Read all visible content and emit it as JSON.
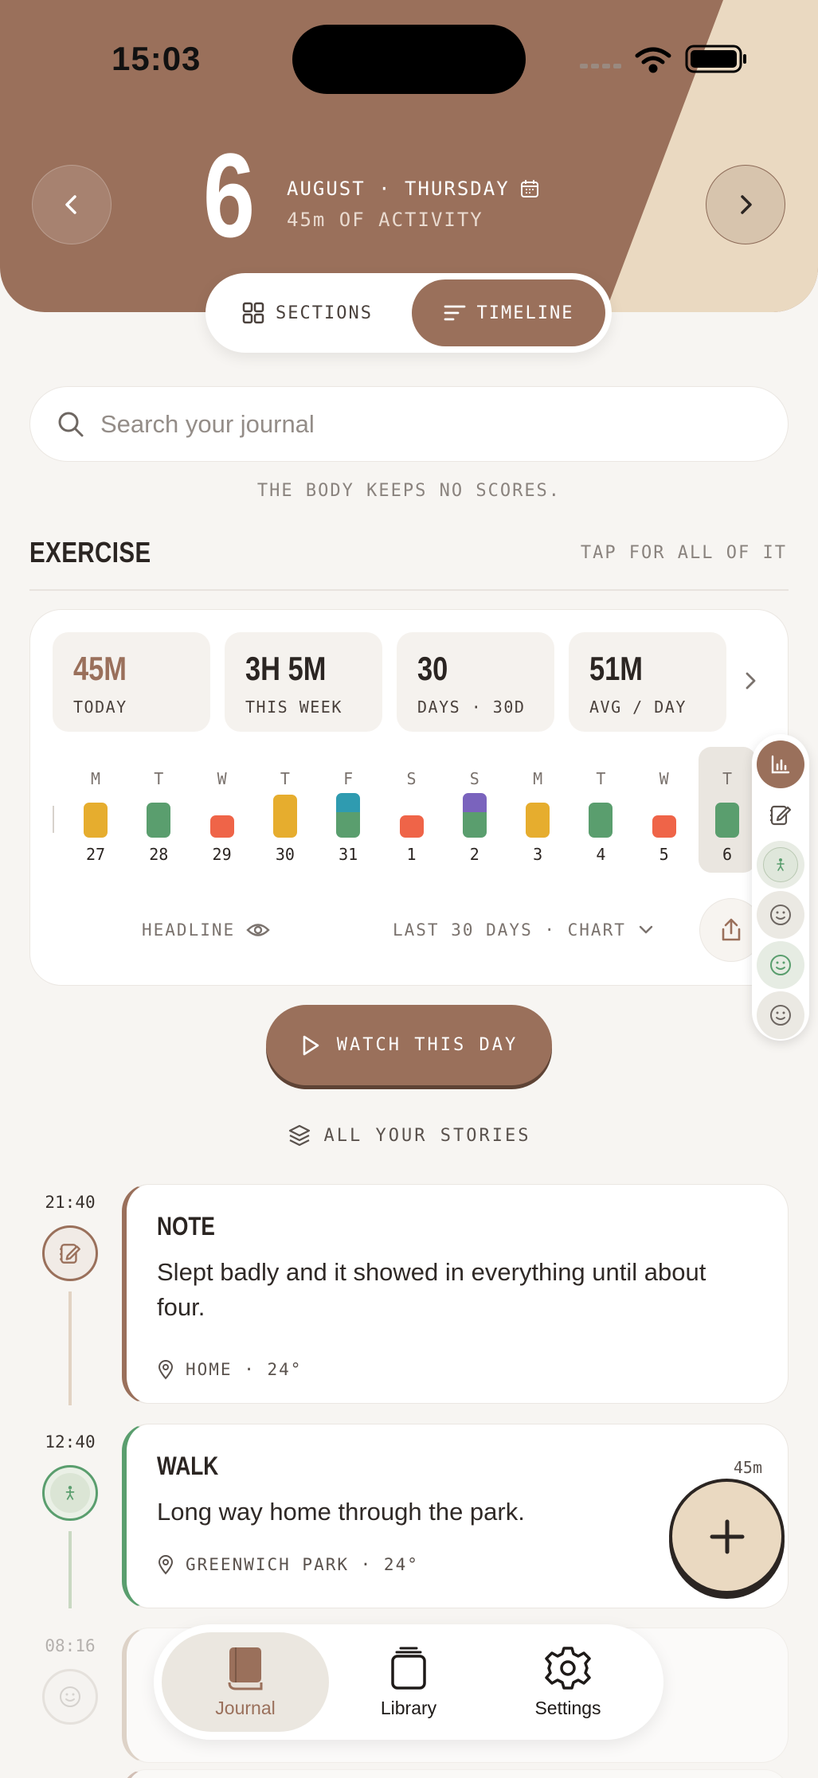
{
  "status_bar": {
    "time": "15:03"
  },
  "header": {
    "day": "6",
    "date": "AUGUST · THURSDAY",
    "activity": "45m OF ACTIVITY"
  },
  "view_toggle": {
    "sections_label": "SECTIONS",
    "timeline_label": "TIMELINE",
    "selected": "TIMELINE"
  },
  "search": {
    "placeholder": "Search your journal"
  },
  "tagline": "THE BODY KEEPS NO SCORES.",
  "section": {
    "title": "EXERCISE",
    "link": "TAP FOR ALL OF IT"
  },
  "stats": [
    {
      "value": "45M",
      "label": "TODAY"
    },
    {
      "value": "3H 5M",
      "label": "THIS WEEK"
    },
    {
      "value": "30",
      "label": "DAYS · 30D"
    },
    {
      "value": "51M",
      "label": "AVG / DAY"
    }
  ],
  "days": [
    {
      "letter": "M",
      "number": "27",
      "segments": [
        "#e6ad2e"
      ]
    },
    {
      "letter": "T",
      "number": "28",
      "segments": [
        "#5a9e6e"
      ]
    },
    {
      "letter": "W",
      "number": "29",
      "segments": [
        "#ef6448"
      ]
    },
    {
      "letter": "T",
      "number": "30",
      "segments": [
        "#e6ad2e"
      ]
    },
    {
      "letter": "F",
      "number": "31",
      "segments": [
        "#2f9bb0",
        "#5a9e6e"
      ]
    },
    {
      "letter": "S",
      "number": "1",
      "segments": [
        "#ef6448"
      ]
    },
    {
      "letter": "S",
      "number": "2",
      "segments": [
        "#7a63bd",
        "#5a9e6e"
      ]
    },
    {
      "letter": "M",
      "number": "3",
      "segments": [
        "#e6ad2e"
      ]
    },
    {
      "letter": "T",
      "number": "4",
      "segments": [
        "#5a9e6e"
      ]
    },
    {
      "letter": "W",
      "number": "5",
      "segments": [
        "#ef6448"
      ]
    },
    {
      "letter": "T",
      "number": "6",
      "segments": [
        "#5a9e6e"
      ],
      "today": true
    }
  ],
  "card_footer": {
    "headline": "HEADLINE",
    "range": "LAST 30 DAYS · CHART"
  },
  "watch_button": "WATCH THIS DAY",
  "stories_link": "ALL YOUR STORIES",
  "entries": [
    {
      "time": "21:40",
      "title": "NOTE",
      "body": "Slept badly and it showed in everything until about four.",
      "location": "HOME · 24°",
      "icon": "note-icon",
      "accent": "#9a705b"
    },
    {
      "time": "12:40",
      "title": "WALK",
      "body": "Long way home through the park.",
      "location": "GREENWICH PARK · 24°",
      "duration": "45m",
      "icon": "walk-icon",
      "accent": "#5a9e6e"
    },
    {
      "time": "08:16",
      "icon": "mood-icon"
    }
  ],
  "bottom_nav": [
    {
      "label": "Journal",
      "icon": "book-icon",
      "active": true
    },
    {
      "label": "Library",
      "icon": "stack-icon"
    },
    {
      "label": "Settings",
      "icon": "gear-icon"
    }
  ],
  "colors": {
    "brand": "#9a705b",
    "accent_sand": "#ead9c1",
    "green": "#5a9e6e",
    "amber": "#e6ad2e",
    "coral": "#ef6448",
    "teal": "#2f9bb0",
    "purple": "#7a63bd"
  }
}
